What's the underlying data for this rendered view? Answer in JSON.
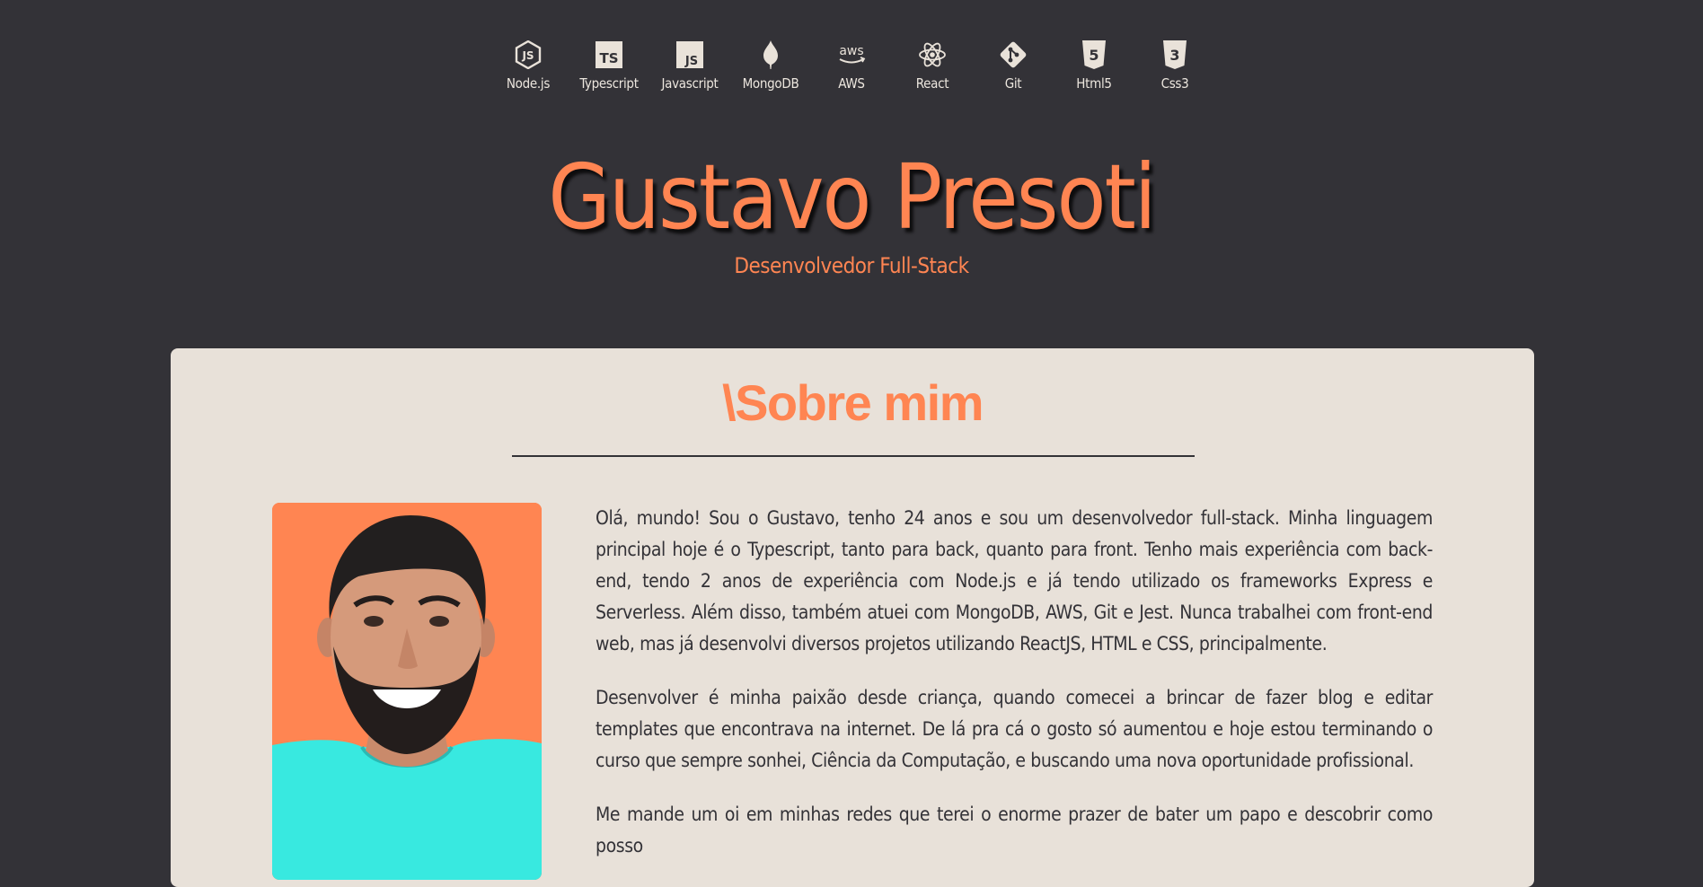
{
  "techs": [
    {
      "label": "Node.js",
      "icon": "nodejs-icon"
    },
    {
      "label": "Typescript",
      "icon": "typescript-icon"
    },
    {
      "label": "Javascript",
      "icon": "javascript-icon"
    },
    {
      "label": "MongoDB",
      "icon": "mongodb-icon"
    },
    {
      "label": "AWS",
      "icon": "aws-icon"
    },
    {
      "label": "React",
      "icon": "react-icon"
    },
    {
      "label": "Git",
      "icon": "git-icon"
    },
    {
      "label": "Html5",
      "icon": "html5-icon"
    },
    {
      "label": "Css3",
      "icon": "css3-icon"
    }
  ],
  "icon_text": {
    "ts": "TS",
    "js": "JS",
    "aws": "aws",
    "html5": "5",
    "css3": "3"
  },
  "hero": {
    "title": "Gustavo Presoti",
    "subtitle": "Desenvolvedor Full-Stack"
  },
  "about": {
    "title": "\\Sobre mim",
    "paragraphs": [
      "Olá, mundo! Sou o Gustavo, tenho 24 anos e sou um desenvolvedor full-stack. Minha linguagem principal hoje é o Typescript, tanto para back, quanto para front. Tenho mais experiência com back-end, tendo 2 anos de experiência com Node.js e já tendo utilizado os frameworks Express e Serverless. Além disso, também atuei com MongoDB, AWS, Git e Jest. Nunca trabalhei com front-end web, mas já desenvolvi diversos projetos utilizando ReactJS, HTML e CSS, principalmente.",
      "Desenvolver é minha paixão desde criança, quando comecei a brincar de fazer blog e editar templates que encontrava na internet. De lá pra cá o gosto só aumentou e hoje estou terminando o curso que sempre sonhei, Ciência da Computação, e buscando uma nova oportunidade profissional.",
      "Me mande um oi em minhas redes que terei o enorme prazer de bater um papo e descobrir como posso"
    ]
  },
  "colors": {
    "background": "#333237",
    "accent": "#ff8552",
    "card": "#e8e1d9",
    "text_light": "#ece6de",
    "text_dark": "#333237"
  }
}
